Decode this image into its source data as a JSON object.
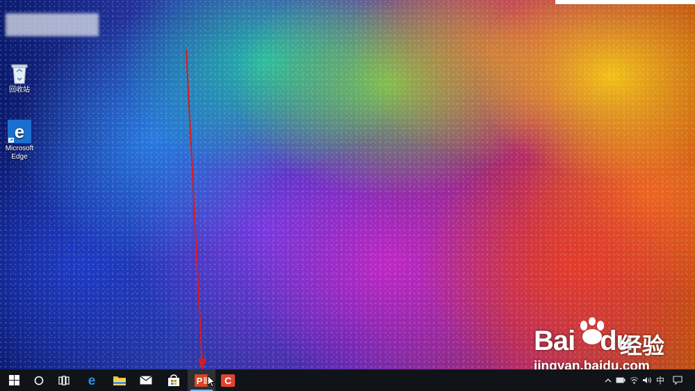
{
  "desktop": {
    "icons": [
      {
        "label": "回收站",
        "icon": "recycle-bin-icon"
      },
      {
        "label": "Microsoft Edge",
        "icon": "edge-icon"
      }
    ],
    "wallpaper_colors": [
      "#1a2ea8",
      "#1ec8aa",
      "#f5c814",
      "#e63c28",
      "#c828c8"
    ]
  },
  "watermark": {
    "logo": "Bai",
    "logo_tail": "du",
    "cn": "经验",
    "url": "jingyan.baidu.com"
  },
  "taskbar": {
    "background": "#101418",
    "pinned": [
      {
        "name": "start-button",
        "icon": "windows-logo-icon"
      },
      {
        "name": "cortana-button",
        "icon": "circle-search-icon"
      },
      {
        "name": "task-view-button",
        "icon": "task-view-icon"
      },
      {
        "name": "edge-taskbar-button",
        "icon": "edge-icon"
      },
      {
        "name": "file-explorer-button",
        "icon": "folder-icon"
      },
      {
        "name": "mail-button",
        "icon": "mail-icon"
      },
      {
        "name": "store-button",
        "icon": "store-bag-icon"
      },
      {
        "name": "powerpoint-button",
        "icon": "powerpoint-icon",
        "label": "P"
      },
      {
        "name": "app-button",
        "icon": "red-app-icon",
        "label": "C"
      }
    ],
    "tray": {
      "ime": "中",
      "icons": [
        "chevron-up-icon",
        "battery-icon",
        "wifi-icon",
        "volume-icon",
        "notification-icon"
      ]
    }
  },
  "annotation": {
    "color": "#e01818"
  }
}
